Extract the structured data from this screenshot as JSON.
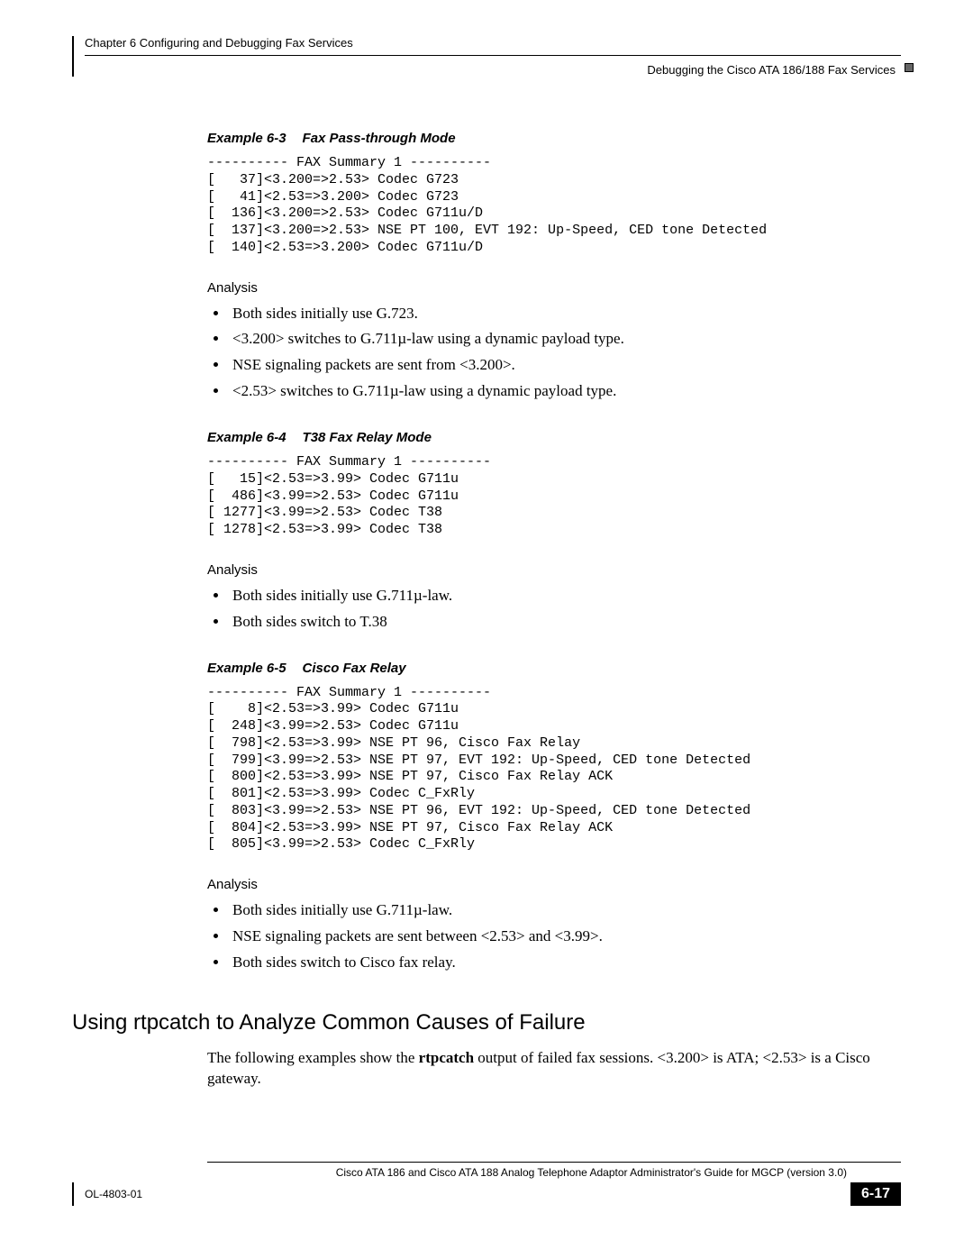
{
  "header": {
    "chapter_line": "Chapter 6    Configuring and Debugging Fax Services",
    "section_line": "Debugging the Cisco ATA 186/188 Fax Services"
  },
  "example63": {
    "label": "Example 6-3",
    "title": "Fax Pass-through Mode",
    "code": "---------- FAX Summary 1 ----------\n[   37]<3.200=>2.53> Codec G723\n[   41]<2.53=>3.200> Codec G723\n[  136]<3.200=>2.53> Codec G711u/D\n[  137]<3.200=>2.53> NSE PT 100, EVT 192: Up-Speed, CED tone Detected\n[  140]<2.53=>3.200> Codec G711u/D",
    "analysis_heading": "Analysis",
    "analysis": [
      "Both sides initially use G.723.",
      "<3.200> switches to G.711µ-law using a dynamic payload type.",
      "NSE signaling packets are sent from <3.200>.",
      "<2.53> switches to G.711µ-law using a dynamic payload type."
    ]
  },
  "example64": {
    "label": "Example 6-4",
    "title": "T38 Fax Relay Mode",
    "code": "---------- FAX Summary 1 ----------\n[   15]<2.53=>3.99> Codec G711u\n[  486]<3.99=>2.53> Codec G711u\n[ 1277]<3.99=>2.53> Codec T38\n[ 1278]<2.53=>3.99> Codec T38",
    "analysis_heading": "Analysis",
    "analysis": [
      "Both sides initially use G.711µ-law.",
      "Both sides switch to T.38"
    ]
  },
  "example65": {
    "label": "Example 6-5",
    "title": "Cisco Fax Relay",
    "code": "---------- FAX Summary 1 ----------\n[    8]<2.53=>3.99> Codec G711u\n[  248]<3.99=>2.53> Codec G711u\n[  798]<2.53=>3.99> NSE PT 96, Cisco Fax Relay\n[  799]<3.99=>2.53> NSE PT 97, EVT 192: Up-Speed, CED tone Detected\n[  800]<2.53=>3.99> NSE PT 97, Cisco Fax Relay ACK\n[  801]<2.53=>3.99> Codec C_FxRly\n[  803]<3.99=>2.53> NSE PT 96, EVT 192: Up-Speed, CED tone Detected\n[  804]<2.53=>3.99> NSE PT 97, Cisco Fax Relay ACK\n[  805]<3.99=>2.53> Codec C_FxRly",
    "analysis_heading": "Analysis",
    "analysis": [
      "Both sides initially use G.711µ-law.",
      "NSE signaling packets are sent between <2.53> and <3.99>.",
      "Both sides switch to Cisco fax relay."
    ]
  },
  "section": {
    "heading": "Using rtpcatch to Analyze Common Causes of Failure",
    "intro_before": "The following examples show the ",
    "intro_bold": "rtpcatch",
    "intro_after": " output of failed fax sessions. <3.200> is ATA; <2.53> is a Cisco gateway."
  },
  "footer": {
    "guide_title": "Cisco ATA 186 and Cisco ATA 188 Analog Telephone Adaptor Administrator's Guide for MGCP (version 3.0)",
    "doc_id": "OL-4803-01",
    "page_number": "6-17"
  }
}
